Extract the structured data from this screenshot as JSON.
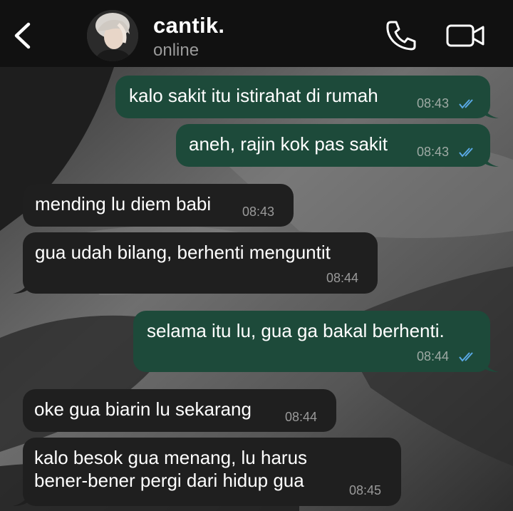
{
  "header": {
    "contact_name": "cantik.",
    "status": "online"
  },
  "colors": {
    "header_bg": "#111111",
    "outgoing_bubble": "#1d4a3a",
    "incoming_bubble": "#1f1f1f",
    "read_ticks": "#5aa9e6"
  },
  "messages": [
    {
      "direction": "out",
      "text": "kalo sakit itu istirahat di rumah",
      "time": "08:43",
      "read": true
    },
    {
      "direction": "out",
      "text": "aneh, rajin kok pas sakit",
      "time": "08:43",
      "read": true
    },
    {
      "direction": "in",
      "text": "mending lu diem babi",
      "time": "08:43"
    },
    {
      "direction": "in",
      "text": "gua udah bilang, berhenti menguntit",
      "time": "08:44"
    },
    {
      "direction": "out",
      "text": "selama itu lu, gua ga bakal berhenti.",
      "time": "08:44",
      "read": true
    },
    {
      "direction": "in",
      "text": "oke gua biarin lu sekarang",
      "time": "08:44"
    },
    {
      "direction": "in",
      "text_lines": [
        "kalo besok gua menang, lu harus",
        "bener-bener pergi dari hidup gua"
      ],
      "time": "08:45"
    }
  ]
}
